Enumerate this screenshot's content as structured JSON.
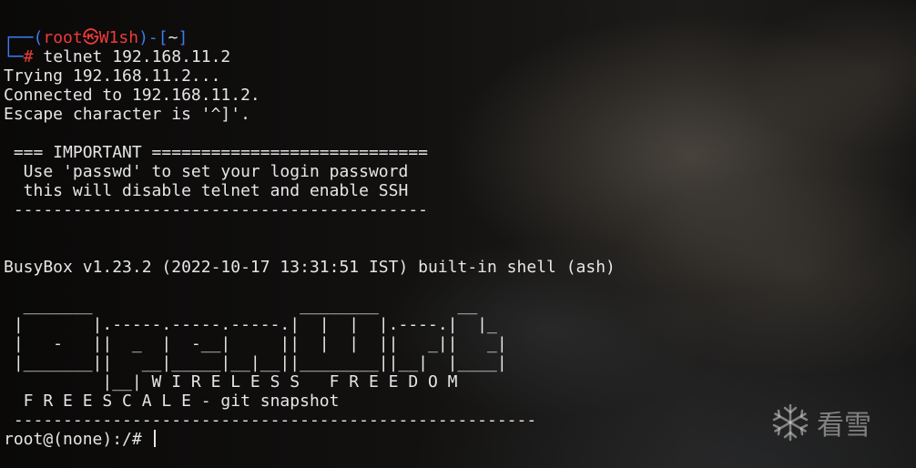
{
  "prompt": {
    "box_top": "┌──",
    "box_bottom": "└─",
    "user": "root",
    "at_symbol": "㉿",
    "host": "W1sh",
    "dir_open": ")-[",
    "dir": "~",
    "dir_close": "]",
    "paren_open": "(",
    "hash": "#",
    "command": " telnet 192.168.11.2"
  },
  "output": [
    "Trying 192.168.11.2...",
    "Connected to 192.168.11.2.",
    "Escape character is '^]'.",
    "",
    " === IMPORTANT ============================",
    "  Use 'passwd' to set your login password",
    "  this will disable telnet and enable SSH",
    " ------------------------------------------",
    "",
    "",
    "BusyBox v1.23.2 (2022-10-17 13:31:51 IST) built-in shell (ash)",
    ""
  ],
  "banner": [
    "  _______                     ________        __",
    " |       |.-----.-----.-----.|  |  |  |.----.|  |_",
    " |   -   ||  _  |  -__|     ||  |  |  ||   _||   _|",
    " |_______||   __|_____|__|__||________||__|  |____|",
    "          |__| W I R E L E S S   F R E E D O M",
    "  F R E E S C A L E - git snapshot",
    " -----------------------------------------------------"
  ],
  "shell_prompt": "root@(none):/# ",
  "watermark_text": "看雪",
  "colors": {
    "prompt_blue": "#3d7bf0",
    "prompt_red": "#ef3b3b",
    "text": "#e6e6e6"
  }
}
